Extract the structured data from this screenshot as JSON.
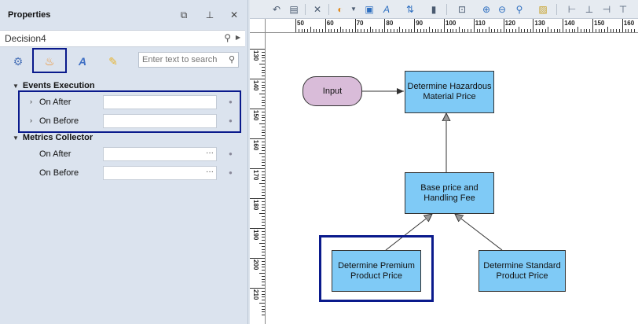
{
  "properties_panel": {
    "title": "Properties",
    "buttons": {
      "float": "⧉",
      "pin": "⊥",
      "close": "✕"
    },
    "object_name": "Decision4",
    "search_placeholder": "Enter text to search",
    "toolbar_icons": [
      "gears-icon",
      "flame-icon",
      "text-style-icon",
      "note-icon"
    ],
    "categories": [
      {
        "name": "Events Execution",
        "rows": [
          {
            "label": "On After",
            "value": ""
          },
          {
            "label": "On Before",
            "value": ""
          }
        ]
      },
      {
        "name": "Metrics Collector",
        "rows": [
          {
            "label": "On After",
            "value": "",
            "ellipsis": "···"
          },
          {
            "label": "On Before",
            "value": "",
            "ellipsis": "···"
          }
        ]
      }
    ]
  },
  "designer": {
    "ruler_h_labels": [
      "50",
      "60",
      "70",
      "80",
      "90",
      "100",
      "110",
      "120",
      "130",
      "140",
      "150",
      "160"
    ],
    "ruler_v_labels": [
      "130",
      "140",
      "150",
      "160",
      "170",
      "180",
      "190",
      "200",
      "210"
    ],
    "nodes": {
      "input": "Input",
      "hazardous": "Determine Hazardous Material Price",
      "base": "Base price and Handling Fee",
      "premium": "Determine Premium Product Price",
      "standard": "Determine Standard Product Price"
    }
  }
}
